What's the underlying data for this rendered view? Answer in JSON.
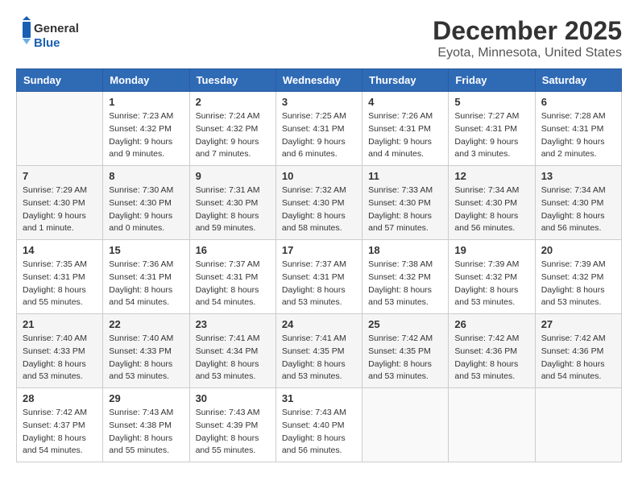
{
  "logo": {
    "line1": "General",
    "line2": "Blue"
  },
  "title": "December 2025",
  "location": "Eyota, Minnesota, United States",
  "days_of_week": [
    "Sunday",
    "Monday",
    "Tuesday",
    "Wednesday",
    "Thursday",
    "Friday",
    "Saturday"
  ],
  "weeks": [
    [
      {
        "day": "",
        "info": ""
      },
      {
        "day": "1",
        "info": "Sunrise: 7:23 AM\nSunset: 4:32 PM\nDaylight: 9 hours\nand 9 minutes."
      },
      {
        "day": "2",
        "info": "Sunrise: 7:24 AM\nSunset: 4:32 PM\nDaylight: 9 hours\nand 7 minutes."
      },
      {
        "day": "3",
        "info": "Sunrise: 7:25 AM\nSunset: 4:31 PM\nDaylight: 9 hours\nand 6 minutes."
      },
      {
        "day": "4",
        "info": "Sunrise: 7:26 AM\nSunset: 4:31 PM\nDaylight: 9 hours\nand 4 minutes."
      },
      {
        "day": "5",
        "info": "Sunrise: 7:27 AM\nSunset: 4:31 PM\nDaylight: 9 hours\nand 3 minutes."
      },
      {
        "day": "6",
        "info": "Sunrise: 7:28 AM\nSunset: 4:31 PM\nDaylight: 9 hours\nand 2 minutes."
      }
    ],
    [
      {
        "day": "7",
        "info": "Sunrise: 7:29 AM\nSunset: 4:30 PM\nDaylight: 9 hours\nand 1 minute."
      },
      {
        "day": "8",
        "info": "Sunrise: 7:30 AM\nSunset: 4:30 PM\nDaylight: 9 hours\nand 0 minutes."
      },
      {
        "day": "9",
        "info": "Sunrise: 7:31 AM\nSunset: 4:30 PM\nDaylight: 8 hours\nand 59 minutes."
      },
      {
        "day": "10",
        "info": "Sunrise: 7:32 AM\nSunset: 4:30 PM\nDaylight: 8 hours\nand 58 minutes."
      },
      {
        "day": "11",
        "info": "Sunrise: 7:33 AM\nSunset: 4:30 PM\nDaylight: 8 hours\nand 57 minutes."
      },
      {
        "day": "12",
        "info": "Sunrise: 7:34 AM\nSunset: 4:30 PM\nDaylight: 8 hours\nand 56 minutes."
      },
      {
        "day": "13",
        "info": "Sunrise: 7:34 AM\nSunset: 4:30 PM\nDaylight: 8 hours\nand 56 minutes."
      }
    ],
    [
      {
        "day": "14",
        "info": "Sunrise: 7:35 AM\nSunset: 4:31 PM\nDaylight: 8 hours\nand 55 minutes."
      },
      {
        "day": "15",
        "info": "Sunrise: 7:36 AM\nSunset: 4:31 PM\nDaylight: 8 hours\nand 54 minutes."
      },
      {
        "day": "16",
        "info": "Sunrise: 7:37 AM\nSunset: 4:31 PM\nDaylight: 8 hours\nand 54 minutes."
      },
      {
        "day": "17",
        "info": "Sunrise: 7:37 AM\nSunset: 4:31 PM\nDaylight: 8 hours\nand 53 minutes."
      },
      {
        "day": "18",
        "info": "Sunrise: 7:38 AM\nSunset: 4:32 PM\nDaylight: 8 hours\nand 53 minutes."
      },
      {
        "day": "19",
        "info": "Sunrise: 7:39 AM\nSunset: 4:32 PM\nDaylight: 8 hours\nand 53 minutes."
      },
      {
        "day": "20",
        "info": "Sunrise: 7:39 AM\nSunset: 4:32 PM\nDaylight: 8 hours\nand 53 minutes."
      }
    ],
    [
      {
        "day": "21",
        "info": "Sunrise: 7:40 AM\nSunset: 4:33 PM\nDaylight: 8 hours\nand 53 minutes."
      },
      {
        "day": "22",
        "info": "Sunrise: 7:40 AM\nSunset: 4:33 PM\nDaylight: 8 hours\nand 53 minutes."
      },
      {
        "day": "23",
        "info": "Sunrise: 7:41 AM\nSunset: 4:34 PM\nDaylight: 8 hours\nand 53 minutes."
      },
      {
        "day": "24",
        "info": "Sunrise: 7:41 AM\nSunset: 4:35 PM\nDaylight: 8 hours\nand 53 minutes."
      },
      {
        "day": "25",
        "info": "Sunrise: 7:42 AM\nSunset: 4:35 PM\nDaylight: 8 hours\nand 53 minutes."
      },
      {
        "day": "26",
        "info": "Sunrise: 7:42 AM\nSunset: 4:36 PM\nDaylight: 8 hours\nand 53 minutes."
      },
      {
        "day": "27",
        "info": "Sunrise: 7:42 AM\nSunset: 4:36 PM\nDaylight: 8 hours\nand 54 minutes."
      }
    ],
    [
      {
        "day": "28",
        "info": "Sunrise: 7:42 AM\nSunset: 4:37 PM\nDaylight: 8 hours\nand 54 minutes."
      },
      {
        "day": "29",
        "info": "Sunrise: 7:43 AM\nSunset: 4:38 PM\nDaylight: 8 hours\nand 55 minutes."
      },
      {
        "day": "30",
        "info": "Sunrise: 7:43 AM\nSunset: 4:39 PM\nDaylight: 8 hours\nand 55 minutes."
      },
      {
        "day": "31",
        "info": "Sunrise: 7:43 AM\nSunset: 4:40 PM\nDaylight: 8 hours\nand 56 minutes."
      },
      {
        "day": "",
        "info": ""
      },
      {
        "day": "",
        "info": ""
      },
      {
        "day": "",
        "info": ""
      }
    ]
  ]
}
